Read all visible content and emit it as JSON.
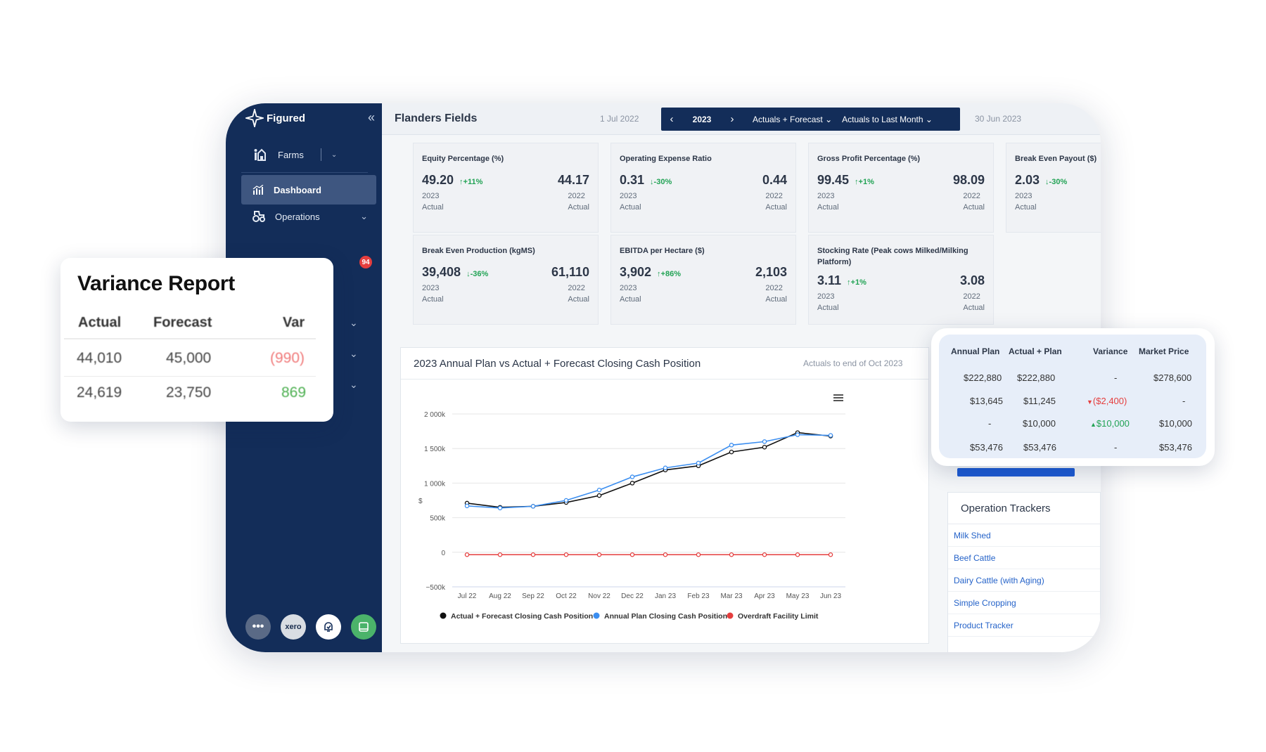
{
  "app": {
    "name": "Figured"
  },
  "sidebar": {
    "farm_selector": "Farms",
    "items": [
      {
        "label": "Dashboard",
        "active": true
      },
      {
        "label": "Operations",
        "active": false
      }
    ],
    "notification_count": "94",
    "bottom_buttons": [
      "more",
      "xero",
      "alerts",
      "notes"
    ],
    "xero_label": "xero"
  },
  "topbar": {
    "farm_name": "Flanders Fields",
    "period_start": "1 Jul 2022",
    "period_end": "30 Jun 2023",
    "year": "2023",
    "view_mode": "Actuals + Forecast",
    "actuals_range": "Actuals to Last Month"
  },
  "kpis": [
    {
      "title": "Equity Percentage (%)",
      "current": "49.20",
      "change": "+11%",
      "direction": "up",
      "current_year": "2023",
      "current_label": "Actual",
      "prior": "44.17",
      "prior_year": "2022",
      "prior_label": "Actual"
    },
    {
      "title": "Operating Expense Ratio",
      "current": "0.31",
      "change": "-30%",
      "direction": "down",
      "current_year": "2023",
      "current_label": "Actual",
      "prior": "0.44",
      "prior_year": "2022",
      "prior_label": "Actual"
    },
    {
      "title": "Gross Profit Percentage (%)",
      "current": "99.45",
      "change": "+1%",
      "direction": "up",
      "current_year": "2023",
      "current_label": "Actual",
      "prior": "98.09",
      "prior_year": "2022",
      "prior_label": "Actual"
    },
    {
      "title": "Break Even Payout ($)",
      "current": "2.03",
      "change": "-30%",
      "direction": "down",
      "current_year": "2023",
      "current_label": "Actual",
      "prior": "",
      "prior_year": "",
      "prior_label": ""
    },
    {
      "title": "Break Even Production (kgMS)",
      "current": "39,408",
      "change": "-36%",
      "direction": "down",
      "current_year": "2023",
      "current_label": "Actual",
      "prior": "61,110",
      "prior_year": "2022",
      "prior_label": "Actual"
    },
    {
      "title": "EBITDA per Hectare ($)",
      "current": "3,902",
      "change": "+86%",
      "direction": "up",
      "current_year": "2023",
      "current_label": "Actual",
      "prior": "2,103",
      "prior_year": "2022",
      "prior_label": "Actual"
    },
    {
      "title": "Stocking Rate (Peak cows Milked/Milking Platform)",
      "current": "3.11",
      "change": "+1%",
      "direction": "up",
      "current_year": "2023",
      "current_label": "Actual",
      "prior": "3.08",
      "prior_year": "2022",
      "prior_label": "Actual"
    }
  ],
  "chart_panel": {
    "title": "2023 Annual Plan vs Actual + Forecast Closing Cash Position",
    "note": "Actuals to end of Oct 2023"
  },
  "chart_data": {
    "type": "line",
    "x": [
      "Jul 22",
      "Aug 22",
      "Sep 22",
      "Oct 22",
      "Nov 22",
      "Dec 22",
      "Jan 23",
      "Feb 23",
      "Mar 23",
      "Apr 23",
      "May 23",
      "Jun 23"
    ],
    "ylabel": "$",
    "ylim": [
      -500000,
      2000000
    ],
    "yticks": [
      -500000,
      0,
      500000,
      1000000,
      1500000,
      2000000
    ],
    "ytick_labels": [
      "−500k",
      "0",
      "500k",
      "1 000k",
      "1 500k",
      "2 000k"
    ],
    "grid": true,
    "legend": "bottom",
    "series": [
      {
        "name": "Actual + Forecast Closing Cash Position",
        "color": "#111111",
        "values": [
          710000,
          650000,
          665000,
          720000,
          820000,
          1000000,
          1190000,
          1250000,
          1450000,
          1520000,
          1730000,
          1680000
        ]
      },
      {
        "name": "Annual Plan Closing Cash Position",
        "color": "#3b8ef0",
        "values": [
          670000,
          640000,
          665000,
          750000,
          900000,
          1090000,
          1220000,
          1290000,
          1550000,
          1600000,
          1700000,
          1690000
        ]
      },
      {
        "name": "Overdraft Facility Limit",
        "color": "#e53e3e",
        "values": [
          -35000,
          -35000,
          -35000,
          -35000,
          -35000,
          -35000,
          -35000,
          -35000,
          -35000,
          -35000,
          -35000,
          -35000
        ]
      }
    ]
  },
  "trackers": {
    "title": "Operation Trackers",
    "items": [
      "Milk Shed",
      "Beef Cattle",
      "Dairy Cattle (with Aging)",
      "Simple Cropping",
      "Product Tracker"
    ]
  },
  "variance_report": {
    "title": "Variance Report",
    "headers": [
      "Actual",
      "Forecast",
      "Var"
    ],
    "rows": [
      {
        "actual": "44,010",
        "forecast": "45,000",
        "var": "(990)",
        "var_color": "#f07a7a"
      },
      {
        "actual": "24,619",
        "forecast": "23,750",
        "var": "869",
        "var_color": "#4caf50"
      }
    ]
  },
  "plan_table": {
    "headers": [
      "Annual Plan",
      "Actual + Plan",
      "Variance",
      "Market Price"
    ],
    "rows": [
      {
        "plan": "$222,880",
        "actual": "$222,880",
        "variance": "-",
        "dir": "none",
        "market": "$278,600"
      },
      {
        "plan": "$13,645",
        "actual": "$11,245",
        "variance": "($2,400)",
        "dir": "down",
        "market": "-"
      },
      {
        "plan": "-",
        "actual": "$10,000",
        "variance": "$10,000",
        "dir": "up",
        "market": "$10,000"
      },
      {
        "plan": "$53,476",
        "actual": "$53,476",
        "variance": "-",
        "dir": "none",
        "market": "$53,476"
      }
    ]
  }
}
